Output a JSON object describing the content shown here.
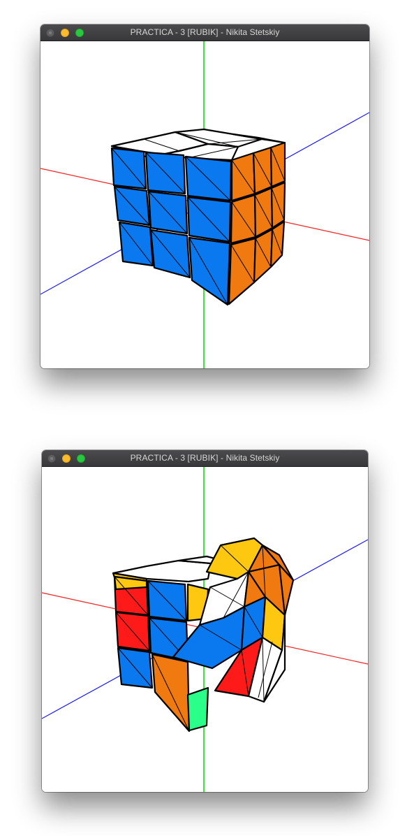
{
  "windows": [
    {
      "title": "PRACTICA - 3 [RUBIK] - Nikita Stetskiy"
    },
    {
      "title": "PRACTICA - 3 [RUBIK] - Nikita Stetskiy"
    }
  ],
  "colors": {
    "blue": "#0a78ee",
    "orange": "#f07a10",
    "white": "#ffffff",
    "red": "#ff1a1a",
    "yellow": "#ffc810",
    "green": "#2aff8a",
    "axis_x": "#ff2020",
    "axis_y": "#00dd00",
    "axis_z": "#1a1aff"
  }
}
